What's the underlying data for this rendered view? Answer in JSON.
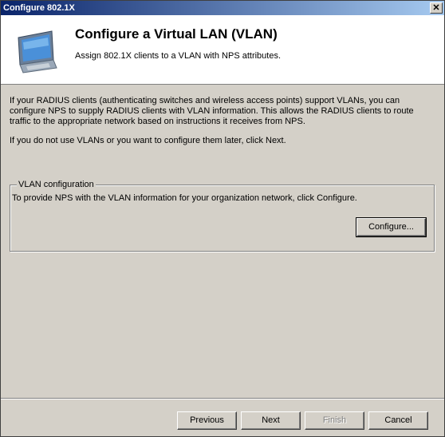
{
  "window": {
    "title": "Configure 802.1X",
    "close_glyph": "✕"
  },
  "header": {
    "title": "Configure a Virtual LAN (VLAN)",
    "subtitle": "Assign 802.1X clients to a VLAN with NPS attributes.",
    "icon": "monitor-icon"
  },
  "body": {
    "paragraph1": "If your RADIUS clients (authenticating switches and wireless access points) support VLANs, you can configure NPS to supply RADIUS clients with VLAN information. This allows the RADIUS clients to route traffic to the appropriate network based on instructions it receives from NPS.",
    "paragraph2": "If you do not use VLANs or you want to configure them later, click Next."
  },
  "vlan_group": {
    "legend": "VLAN configuration",
    "text": "To provide NPS with the VLAN information for your organization network, click Configure.",
    "configure_label": "Configure..."
  },
  "footer": {
    "previous_label": "Previous",
    "next_label": "Next",
    "finish_label": "Finish",
    "cancel_label": "Cancel"
  }
}
